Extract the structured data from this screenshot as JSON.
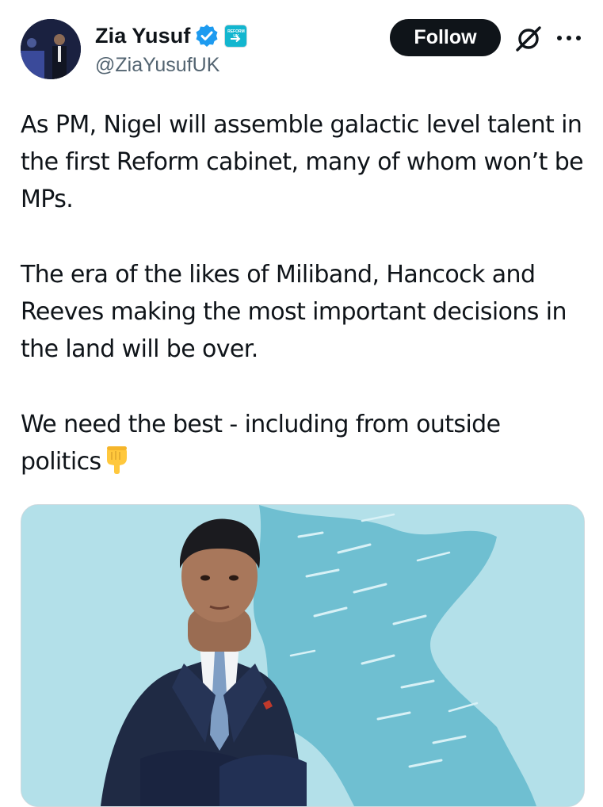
{
  "author": {
    "display_name": "Zia Yusuf",
    "handle": "@ZiaYusufUK",
    "verified_badge_color": "#1d9bf0",
    "affiliation_badge_text": "REFORM UK"
  },
  "actions": {
    "follow_label": "Follow",
    "grok_icon": "grok-icon",
    "more_icon": "more-horizontal-icon"
  },
  "tweet": {
    "paragraphs": [
      "As PM, Nigel will assemble galactic level talent in the first Reform cabinet, many of whom won’t be MPs.",
      "The era of the likes of Miliband, Hancock and Reeves making the most important decisions in the land will be over.",
      "We need the best - including from outside politics"
    ],
    "trailing_emoji": "pointing-down-emoji"
  },
  "media": {
    "description_icon": "photo",
    "background_color": "#a9dbe6"
  }
}
